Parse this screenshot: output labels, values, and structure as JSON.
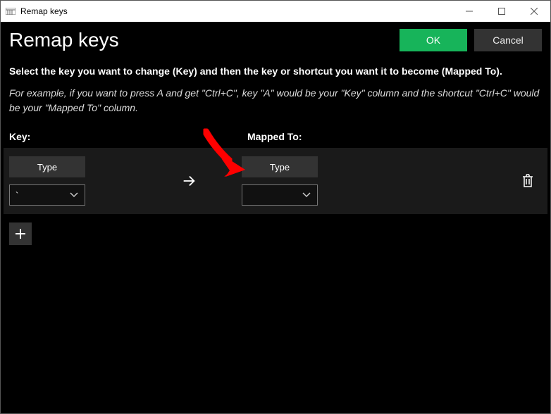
{
  "window": {
    "title": "Remap keys"
  },
  "header": {
    "title": "Remap keys",
    "ok_label": "OK",
    "cancel_label": "Cancel"
  },
  "instructions": {
    "bold": "Select the key you want to change (Key) and then the key or shortcut you want it to become (Mapped To).",
    "italic": "For example, if you want to press A and get \"Ctrl+C\", key \"A\" would be your \"Key\" column and the shortcut \"Ctrl+C\" would be your \"Mapped To\" column."
  },
  "columns": {
    "key_label": "Key:",
    "mapped_label": "Mapped To:"
  },
  "row": {
    "key_type_label": "Type",
    "key_select_value": "`",
    "mapped_type_label": "Type",
    "mapped_select_value": ""
  }
}
